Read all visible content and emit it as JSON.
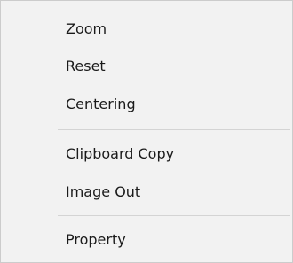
{
  "context_menu": {
    "items": [
      {
        "label": "Zoom"
      },
      {
        "label": "Reset"
      },
      {
        "label": "Centering"
      },
      {
        "label": "Clipboard Copy"
      },
      {
        "label": "Image Out"
      },
      {
        "label": "Property"
      }
    ],
    "colors": {
      "background": "#f2f2f2",
      "border": "#cccccc",
      "separator": "#d4d4d4",
      "text": "#1a1a1a"
    }
  }
}
